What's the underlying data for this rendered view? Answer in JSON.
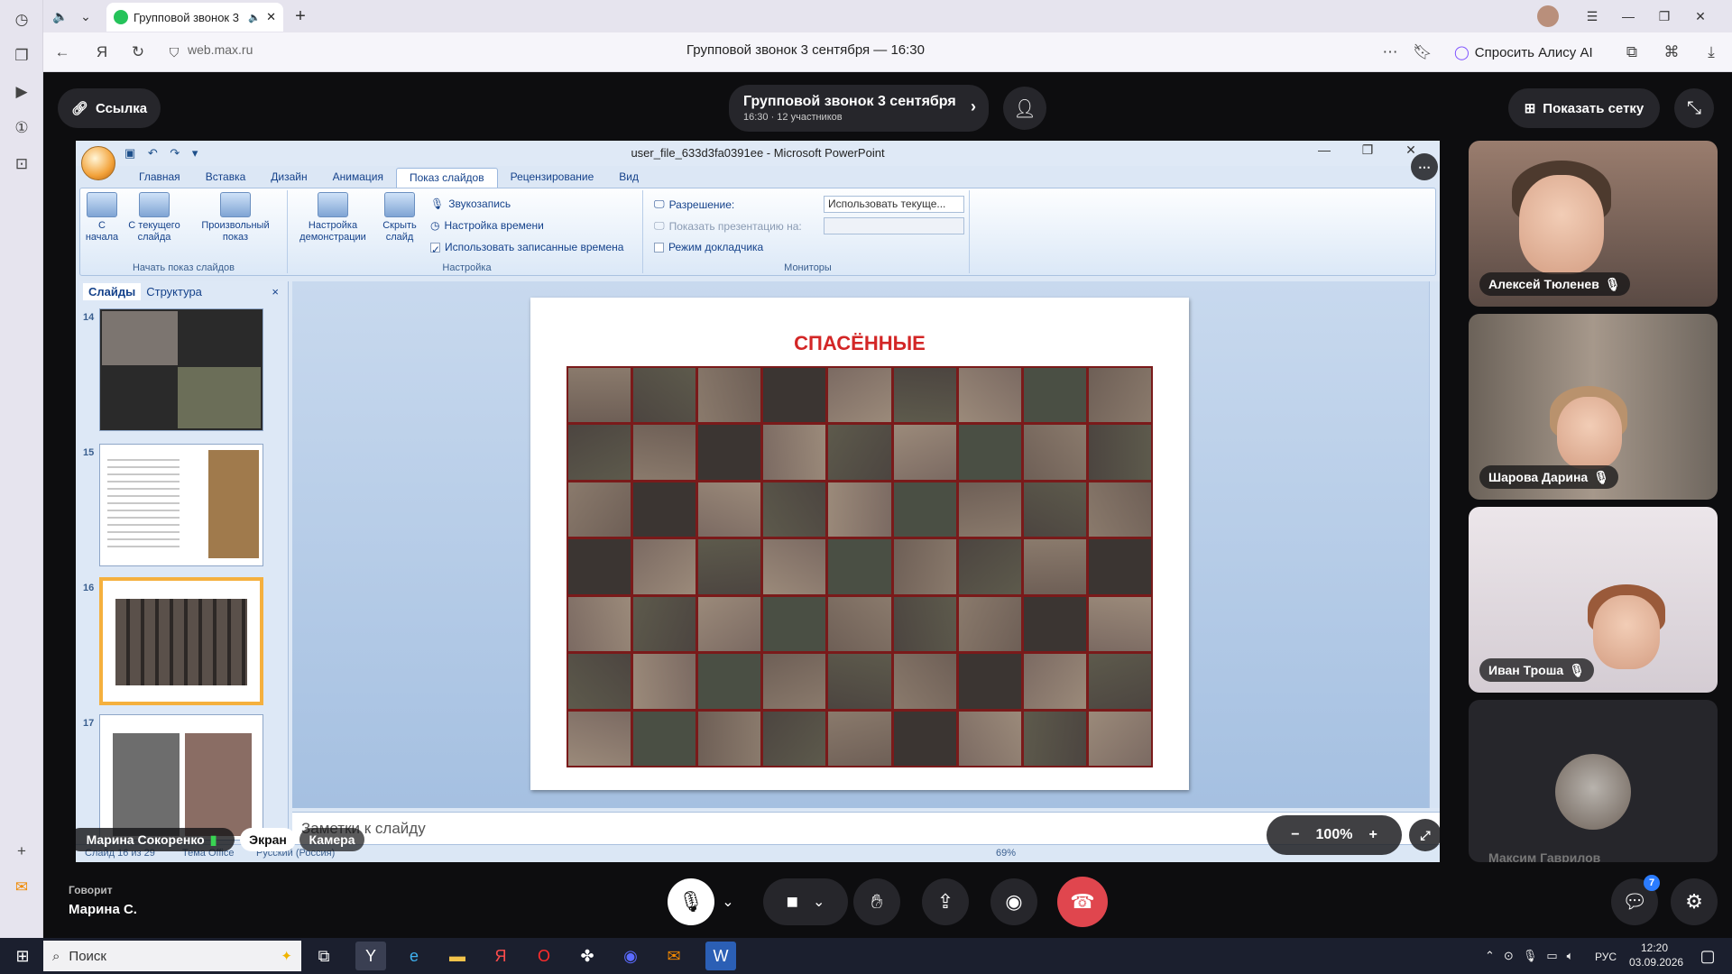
{
  "browser": {
    "tab_title": "Групповой звонок 3",
    "url": "web.max.ru",
    "page_title": "Групповой звонок 3 сентября — 16:30",
    "alice_label": "Спросить Алису AI"
  },
  "call": {
    "link_label": "Ссылка",
    "title": "Групповой звонок 3 сентября",
    "subtitle": "16:30 · 12 участников",
    "show_grid_label": "Показать сетку",
    "speaking_label": "Говорит",
    "speaking_name": "Марина С.",
    "chat_badge": "7",
    "zoom": "100%",
    "presenter_name": "Марина Сокоренко",
    "screen_tab": "Экран",
    "camera_tab": "Камера"
  },
  "participants": [
    {
      "name": "Алексей Тюленев"
    },
    {
      "name": "Шарова Дарина"
    },
    {
      "name": "Иван Троша"
    },
    {
      "name": "Максим Гаврилов"
    }
  ],
  "ppt": {
    "window_title": "user_file_633d3fa0391ee - Microsoft PowerPoint",
    "tabs": [
      "Главная",
      "Вставка",
      "Дизайн",
      "Анимация",
      "Показ слайдов",
      "Рецензирование",
      "Вид"
    ],
    "active_tab": "Показ слайдов",
    "ribbon": {
      "from_start": "С начала",
      "from_current": "С текущего слайда",
      "custom_show": "Произвольный показ",
      "group_start": "Начать показ слайдов",
      "setup_show": "Настройка демонстрации",
      "hide_slide": "Скрыть слайд",
      "record_narration": "Звукозапись",
      "rehearse_timings": "Настройка времени",
      "use_timings": "Использовать записанные времена",
      "group_setup": "Настройка",
      "resolution_label": "Разрешение:",
      "resolution_value": "Использовать текуще...",
      "show_on_label": "Показать презентацию на:",
      "presenter_view": "Режим докладчика",
      "group_monitors": "Мониторы"
    },
    "pane_tabs": [
      "Слайды",
      "Структура"
    ],
    "thumbs": [
      "14",
      "15",
      "16",
      "17"
    ],
    "slide_title": "СПАСЁННЫЕ",
    "notes_placeholder": "Заметки к слайду",
    "status": {
      "slide_info": "Слайд 16 из 29",
      "theme": "Тема Office",
      "language": "Русский (Россия)",
      "zoom": "69%"
    }
  },
  "taskbar": {
    "search_placeholder": "Поиск",
    "language": "РУС",
    "time": "12:20",
    "date": "03.09.2026"
  }
}
